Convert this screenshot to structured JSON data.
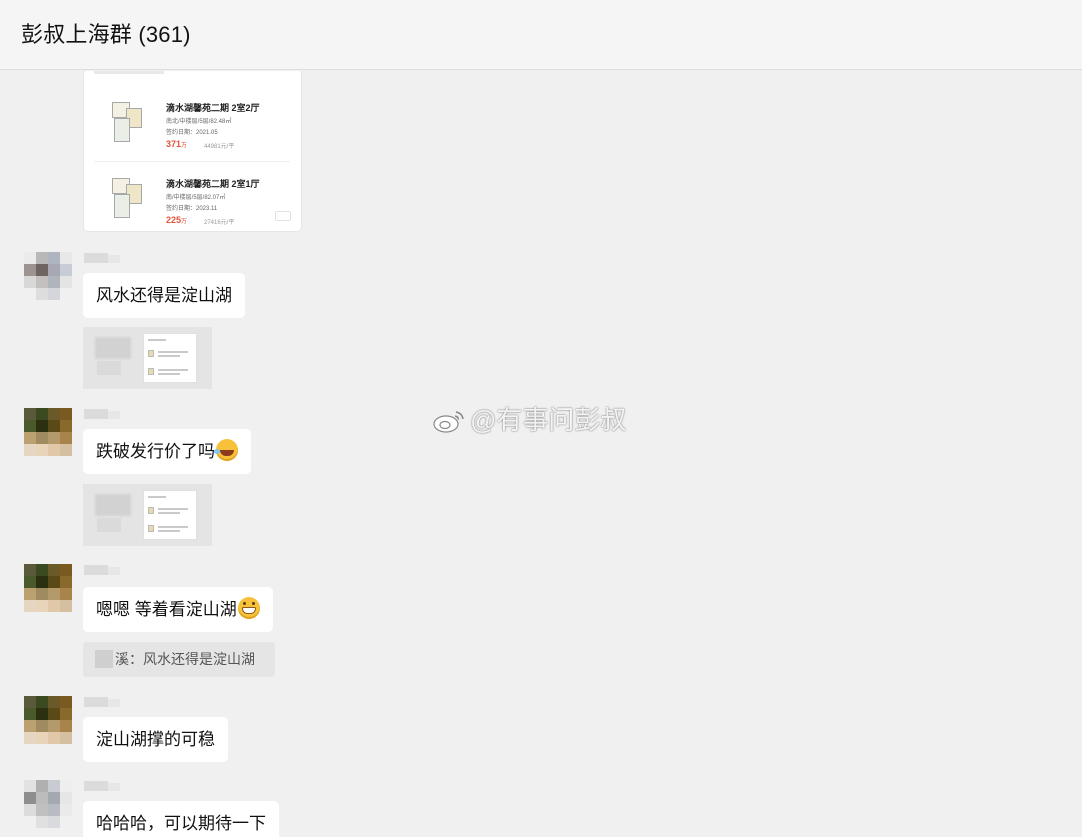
{
  "header": {
    "title": "彭叔上海群 (361)"
  },
  "listing_card": {
    "items": [
      {
        "title": "滴水湖馨苑二期 2室2厅",
        "meta": "南北/中楼层/5层/82.48㎡",
        "date": "签约日期：2021.05",
        "price": "371",
        "price_unit": "万",
        "unit_price": "44981元/平",
        "source": ""
      },
      {
        "title": "滴水湖馨苑二期 2室1厅",
        "meta": "南/中楼层/5层/82.07㎡",
        "date": "签约日期：2023.11",
        "price": "225",
        "price_unit": "万",
        "unit_price": "27416元/平",
        "source": ""
      }
    ]
  },
  "messages": [
    {
      "text": "风水还得是淀山湖"
    },
    {
      "text": "跌破发行价了吗",
      "emoji": "rolling-on-floor-laughing-emoji"
    },
    {
      "text": "嗯嗯 等着看淀山湖",
      "emoji": "grinning-emoji"
    },
    {
      "text": "淀山湖撑的可稳"
    },
    {
      "text": "哈哈哈，可以期待一下"
    }
  ],
  "quote": {
    "text": "溪：风水还得是淀山湖"
  },
  "watermark": {
    "text": "@有事问彭叔",
    "icon": "weibo-icon"
  },
  "colors": {
    "background": "#f0f0f0",
    "bubble": "#ffffff",
    "price": "#e4533b"
  }
}
